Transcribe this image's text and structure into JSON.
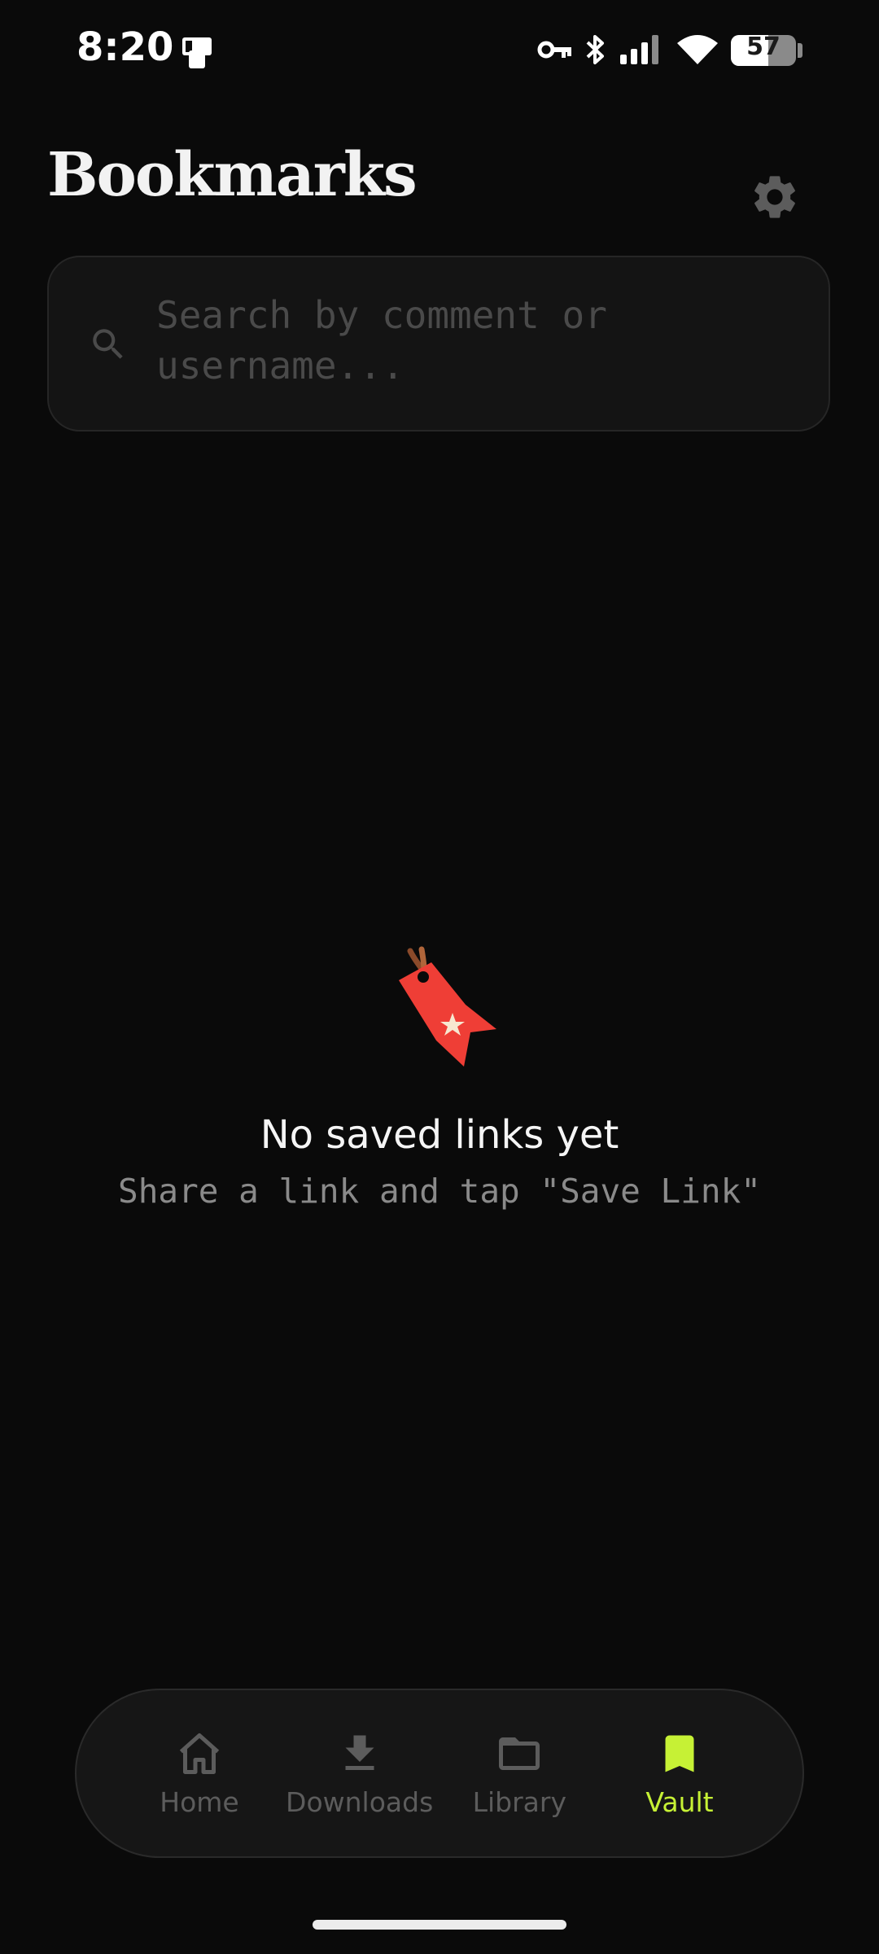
{
  "status_bar": {
    "time": "8:20",
    "battery": 57
  },
  "header": {
    "title": "Bookmarks"
  },
  "search": {
    "placeholder": "Search by comment or username..."
  },
  "empty_state": {
    "title": "No saved links yet",
    "subtitle": "Share a link and tap \"Save Link\""
  },
  "nav": {
    "items": [
      {
        "label": "Home",
        "icon": "home-icon",
        "active": false
      },
      {
        "label": "Downloads",
        "icon": "download-icon",
        "active": false
      },
      {
        "label": "Library",
        "icon": "folder-icon",
        "active": false
      },
      {
        "label": "Vault",
        "icon": "bookmark-icon",
        "active": true
      }
    ]
  },
  "colors": {
    "background": "#0a0a0a",
    "accent": "#c6f135",
    "inactive": "#5c5c5c",
    "tag_red": "#ef3e36"
  }
}
